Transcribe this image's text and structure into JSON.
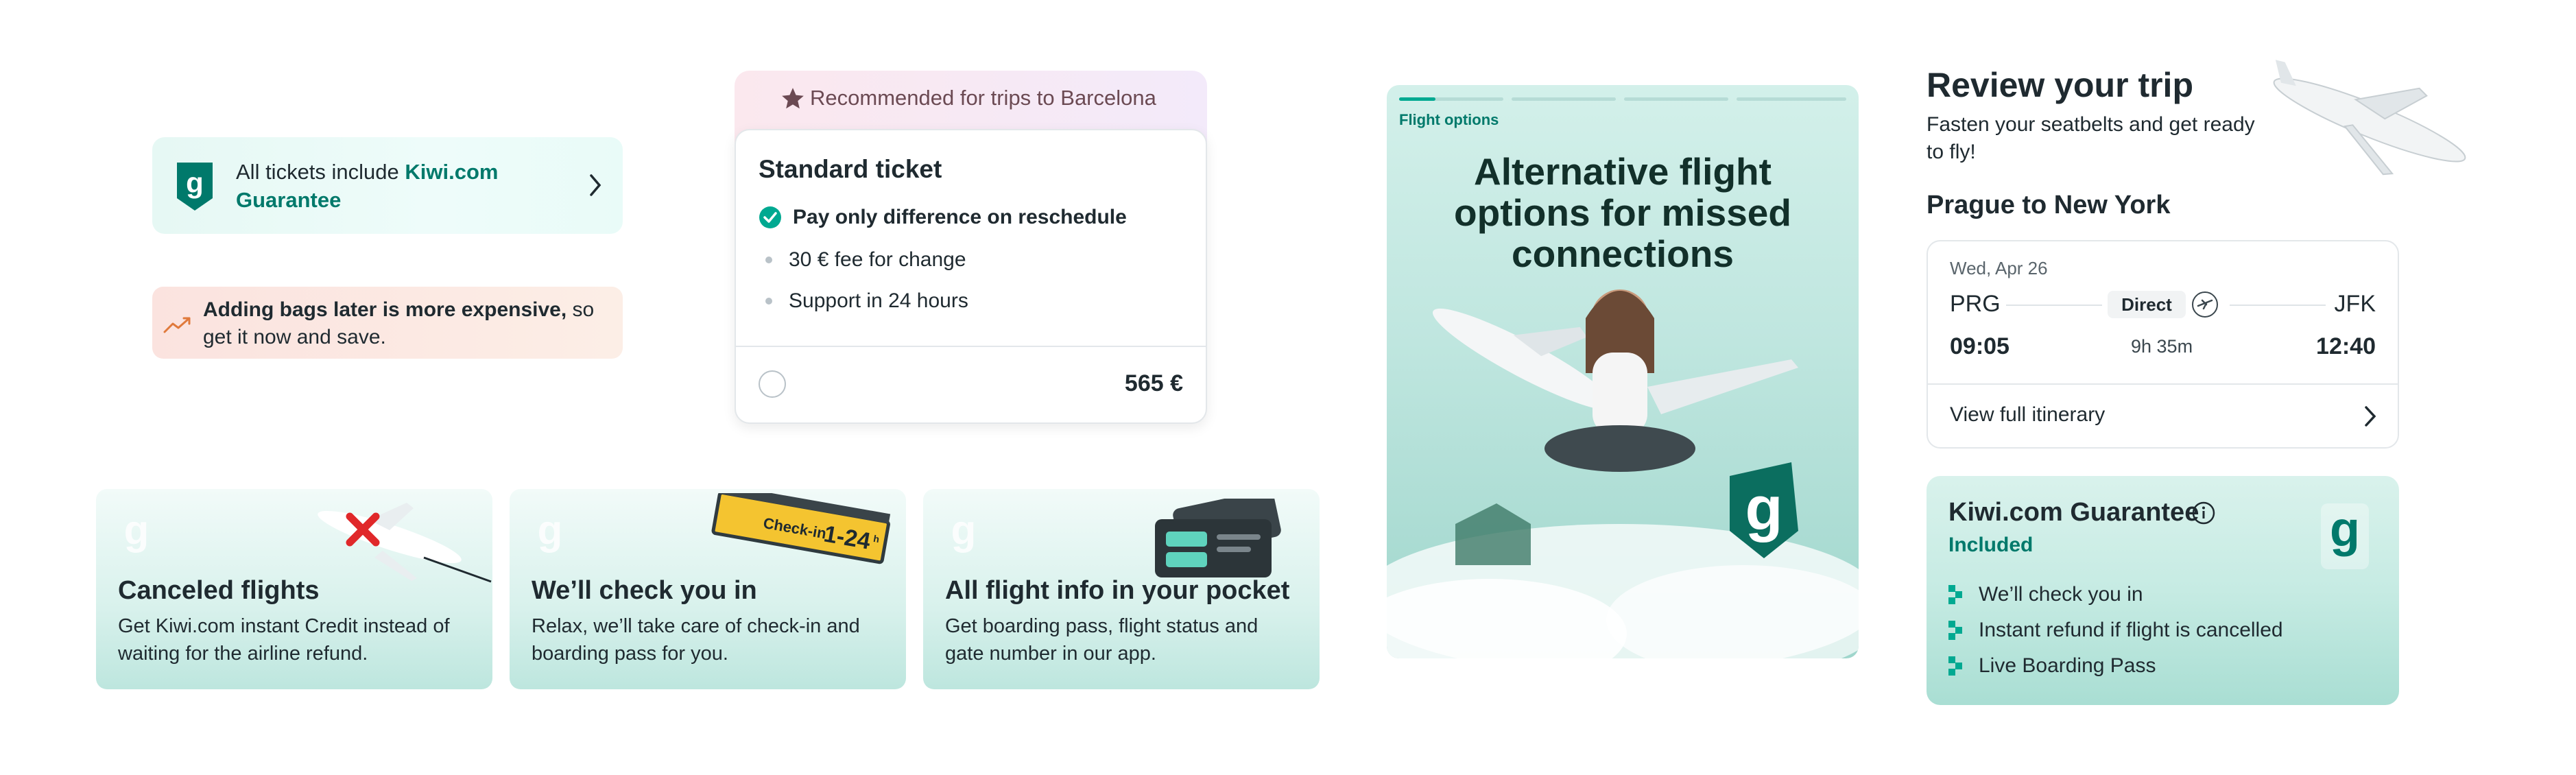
{
  "guarantee_banner": {
    "text": "All tickets include ",
    "link": "Kiwi.com Guarantee",
    "icons": [
      "kiwi-guarantee-icon",
      "chevron-right-icon"
    ]
  },
  "bags_banner": {
    "bold": "Adding bags later is more expensive,",
    "rest": " so get it now and save.",
    "icon": "trending-up-icon"
  },
  "ticket": {
    "recommended": "Recommended for trips to Barcelona",
    "title": "Standard ticket",
    "features": [
      "Pay only difference on reschedule",
      "30 € fee for change",
      "Support in 24 hours"
    ],
    "price": "565 €"
  },
  "feature_cards": [
    {
      "title": "Canceled flights",
      "desc": "Get Kiwi.com instant Credit instead of waiting for the airline refund.",
      "icon": "canceled-plane-icon"
    },
    {
      "title": "We’ll check you in",
      "desc": "Relax, we’ll take care of check-in and boarding pass for you.",
      "icon": "check-in-sign-icon",
      "sign_text": "Check-in  1-24 h"
    },
    {
      "title": "All flight info in your pocket",
      "desc": "Get boarding pass, flight status and gate number in our app.",
      "icon": "boarding-pass-icon"
    }
  ],
  "promo": {
    "tag": "Flight options",
    "headline": "Alternative flight options for missed connections",
    "progress_segments": 4,
    "active_segment": 1,
    "segment_progress": 0.35
  },
  "review": {
    "title": "Review your trip",
    "subtitle": "Fasten your seatbelts and get ready to fly!",
    "route": "Prague to New York",
    "flight": {
      "date": "Wed, Apr 26",
      "from": "PRG",
      "to": "JFK",
      "type": "Direct",
      "depart": "09:05",
      "duration": "9h 35m",
      "arrive": "12:40"
    },
    "itinerary_link": "View full itinerary"
  },
  "guarantee_card": {
    "title": "Kiwi.com Guarantee",
    "status": "Included",
    "items": [
      "We’ll check you in",
      "Instant refund if flight is cancelled",
      "Live Boarding Pass"
    ]
  },
  "colors": {
    "brand_teal": "#00796b",
    "accent_green": "#00a991",
    "warning_bg": "#fbe3df",
    "promo_bg": "#bfe6df"
  }
}
